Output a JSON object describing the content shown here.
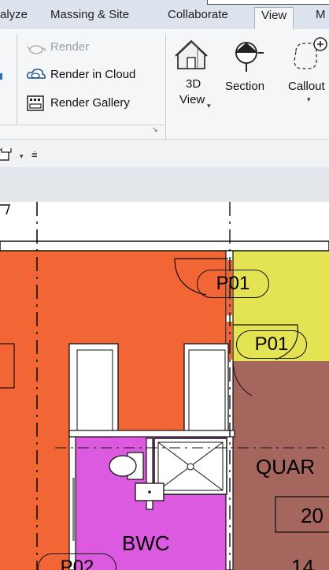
{
  "ribbon": {
    "tabs": [
      {
        "label": "alyze",
        "active": false
      },
      {
        "label": "Massing & Site",
        "active": false
      },
      {
        "label": "Collaborate",
        "active": false
      },
      {
        "label": "View",
        "active": true
      },
      {
        "label": "M",
        "active": false
      }
    ],
    "render_group": {
      "render_label": "Render",
      "render_in_cloud_label": "Render  in Cloud",
      "render_gallery_label": "Render  Gallery"
    },
    "create_group": {
      "view_3d_line1": "3D",
      "view_3d_line2": "View",
      "section_label": "Section",
      "callout_label": "Callout"
    }
  },
  "plan": {
    "tags": {
      "door_tag_1": "P01",
      "door_tag_2": "P01",
      "door_tag_3": "P02"
    },
    "room_names": {
      "bathroom": "BWC",
      "quarters": "QUAR"
    },
    "room_numbers": {
      "quarters_number": "20",
      "bottom_number": "14"
    },
    "colors": {
      "orange_room": "#f26535",
      "magenta_room": "#dc5ae0",
      "yellow_room": "#e4e353",
      "brown_room": "#a5665e"
    }
  }
}
